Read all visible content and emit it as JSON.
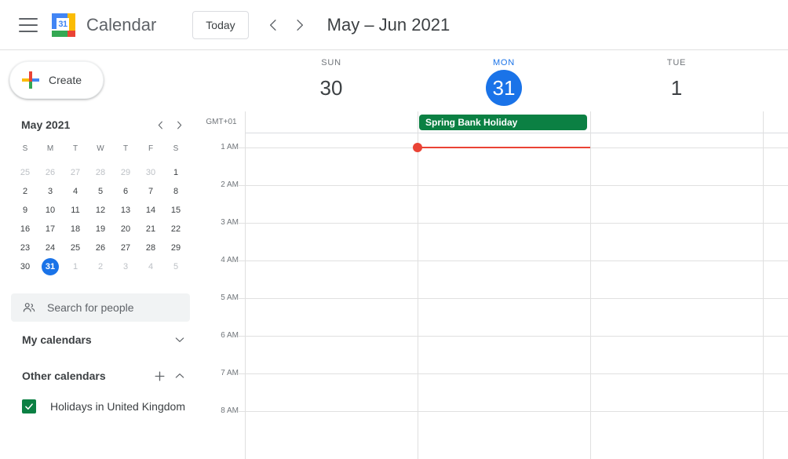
{
  "header": {
    "menu_icon": "hamburger-menu-icon",
    "logo_icon": "google-calendar-logo-icon",
    "logo_day_number": "31",
    "app_title": "Calendar",
    "today_button": "Today",
    "prev_icon": "chevron-left-icon",
    "next_icon": "chevron-right-icon",
    "date_range": "May – Jun 2021"
  },
  "sidebar": {
    "create_button": "Create",
    "create_icon": "multicolor-plus-icon",
    "mini_calendar": {
      "title": "May 2021",
      "prev_icon": "chevron-left-icon",
      "next_icon": "chevron-right-icon",
      "day_initials": [
        "S",
        "M",
        "T",
        "W",
        "T",
        "F",
        "S"
      ],
      "weeks": [
        [
          {
            "d": "25",
            "m": "other"
          },
          {
            "d": "26",
            "m": "other"
          },
          {
            "d": "27",
            "m": "other"
          },
          {
            "d": "28",
            "m": "other"
          },
          {
            "d": "29",
            "m": "other"
          },
          {
            "d": "30",
            "m": "other"
          },
          {
            "d": "1",
            "m": "cur"
          }
        ],
        [
          {
            "d": "2",
            "m": "cur"
          },
          {
            "d": "3",
            "m": "cur"
          },
          {
            "d": "4",
            "m": "cur"
          },
          {
            "d": "5",
            "m": "cur"
          },
          {
            "d": "6",
            "m": "cur"
          },
          {
            "d": "7",
            "m": "cur"
          },
          {
            "d": "8",
            "m": "cur"
          }
        ],
        [
          {
            "d": "9",
            "m": "cur"
          },
          {
            "d": "10",
            "m": "cur"
          },
          {
            "d": "11",
            "m": "cur"
          },
          {
            "d": "12",
            "m": "cur"
          },
          {
            "d": "13",
            "m": "cur"
          },
          {
            "d": "14",
            "m": "cur"
          },
          {
            "d": "15",
            "m": "cur"
          }
        ],
        [
          {
            "d": "16",
            "m": "cur"
          },
          {
            "d": "17",
            "m": "cur"
          },
          {
            "d": "18",
            "m": "cur"
          },
          {
            "d": "19",
            "m": "cur"
          },
          {
            "d": "20",
            "m": "cur"
          },
          {
            "d": "21",
            "m": "cur"
          },
          {
            "d": "22",
            "m": "cur"
          }
        ],
        [
          {
            "d": "23",
            "m": "cur"
          },
          {
            "d": "24",
            "m": "cur"
          },
          {
            "d": "25",
            "m": "cur"
          },
          {
            "d": "26",
            "m": "cur"
          },
          {
            "d": "27",
            "m": "cur"
          },
          {
            "d": "28",
            "m": "cur"
          },
          {
            "d": "29",
            "m": "cur"
          }
        ],
        [
          {
            "d": "30",
            "m": "cur"
          },
          {
            "d": "31",
            "m": "today"
          },
          {
            "d": "1",
            "m": "other"
          },
          {
            "d": "2",
            "m": "other"
          },
          {
            "d": "3",
            "m": "other"
          },
          {
            "d": "4",
            "m": "other"
          },
          {
            "d": "5",
            "m": "other"
          }
        ]
      ]
    },
    "search_people": {
      "placeholder": "Search for people",
      "icon": "people-icon"
    },
    "my_calendars": {
      "label": "My calendars",
      "chevron_icon": "chevron-down-icon"
    },
    "other_calendars": {
      "label": "Other calendars",
      "add_icon": "plus-icon",
      "chevron_icon": "chevron-up-icon",
      "items": [
        {
          "label": "Holidays in United Kingdom",
          "checked": true,
          "color": "#0b8043"
        }
      ]
    }
  },
  "calendar": {
    "timezone_label": "GMT+01",
    "days": [
      {
        "dow": "SUN",
        "num": "30",
        "today": false
      },
      {
        "dow": "MON",
        "num": "31",
        "today": true
      },
      {
        "dow": "TUE",
        "num": "1",
        "today": false
      }
    ],
    "hour_labels": [
      "1 AM",
      "2 AM",
      "3 AM",
      "4 AM",
      "5 AM",
      "6 AM",
      "7 AM",
      "8 AM"
    ],
    "all_day_events": [
      {
        "title": "Spring Bank Holiday",
        "day_index": 1,
        "color": "#0b8043"
      }
    ],
    "now_indicator": {
      "time_label": "1 AM",
      "color": "#ea4335",
      "day_index": 1
    }
  },
  "colors": {
    "accent_blue": "#1a73e8",
    "event_green": "#0b8043",
    "now_red": "#ea4335",
    "text_primary": "#3c4043",
    "text_secondary": "#70757a",
    "grid_line": "#e0e0e0"
  }
}
